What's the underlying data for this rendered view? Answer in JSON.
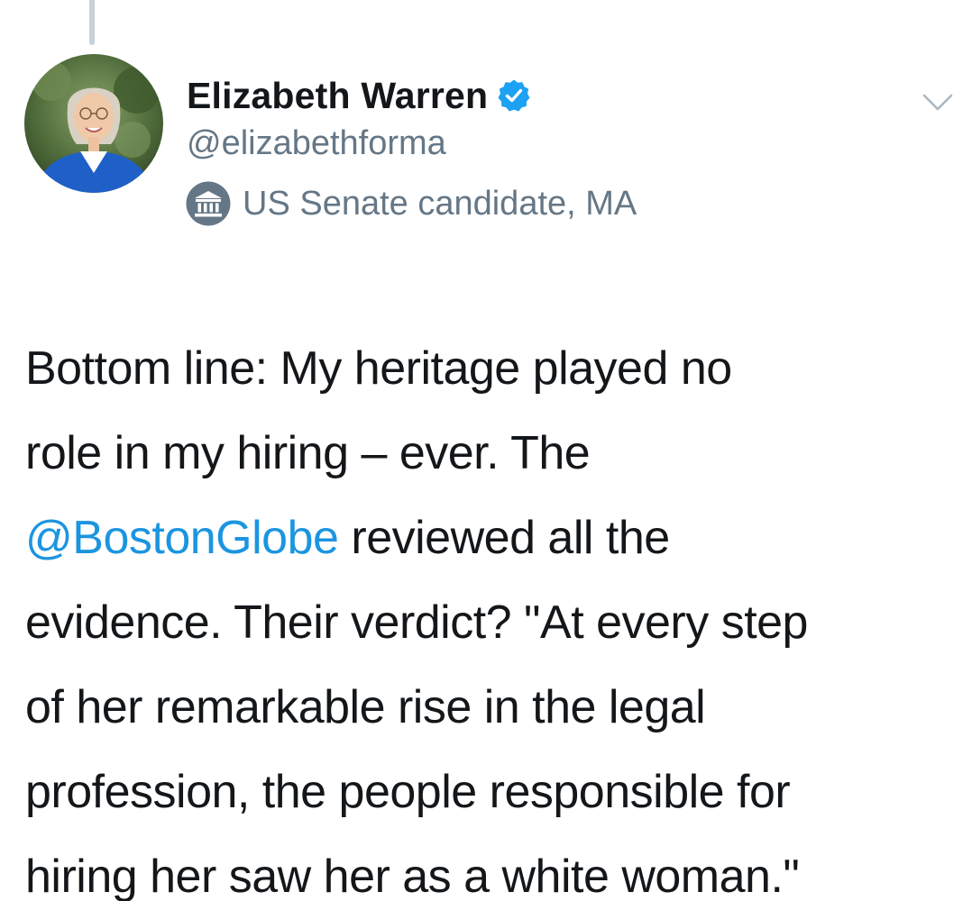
{
  "tweet": {
    "author": {
      "name": "Elizabeth Warren",
      "handle": "@elizabethforma",
      "verified": true,
      "label": "US Senate candidate, MA",
      "label_icon": "government-building-icon",
      "avatar": "profile-photo"
    },
    "text_lines": [
      {
        "before": "Bottom line: My heritage played no",
        "mention": "",
        "after": ""
      },
      {
        "before": "role in my hiring – ever. The",
        "mention": "",
        "after": ""
      },
      {
        "before": "",
        "mention": "@BostonGlobe",
        "after": " reviewed all the"
      },
      {
        "before": "evidence. Their verdict? \"At every step",
        "mention": "",
        "after": ""
      },
      {
        "before": "of her remarkable rise in the legal",
        "mention": "",
        "after": ""
      },
      {
        "before": "profession, the people responsible for",
        "mention": "",
        "after": ""
      },
      {
        "before": "hiring her saw her as a white woman.\"",
        "mention": "",
        "after": ""
      }
    ]
  },
  "colors": {
    "text": "#14171a",
    "secondary": "#657786",
    "link": "#1b95e0",
    "verified": "#1da1f2"
  },
  "icons": {
    "verified": "verified-badge-icon",
    "caret": "chevron-down-icon"
  }
}
